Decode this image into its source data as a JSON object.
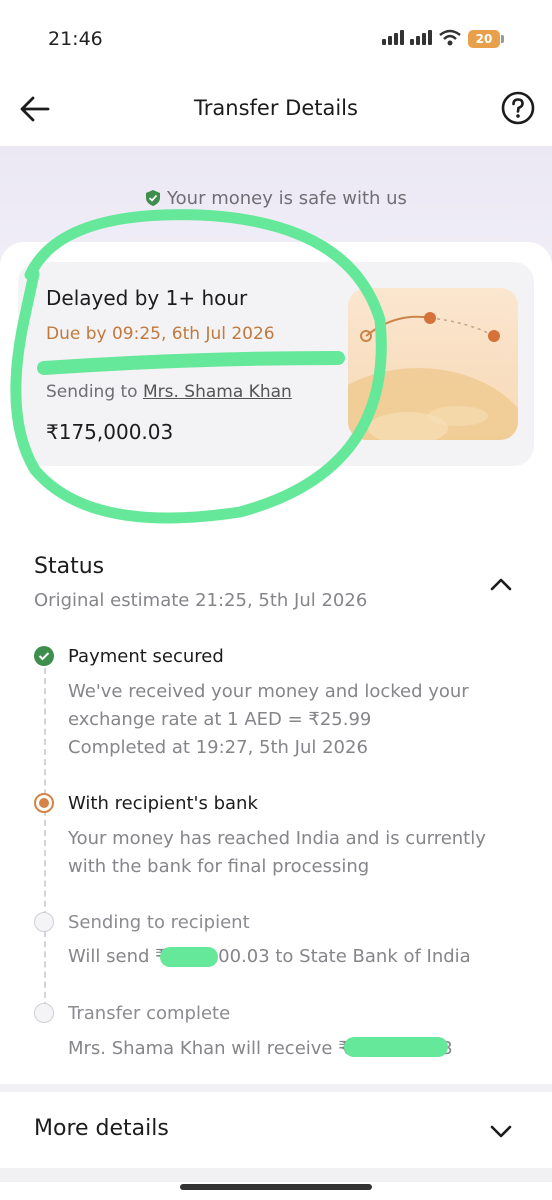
{
  "statusbar": {
    "time": "21:46",
    "battery": "20"
  },
  "header": {
    "title": "Transfer Details",
    "back_icon": "arrow-left-icon",
    "help_icon": "help-circle-icon"
  },
  "safe_banner": {
    "text": "Your money is safe with us",
    "icon": "shield-check-icon"
  },
  "transfer_card": {
    "status": "Delayed by 1+ hour",
    "due": "Due by 09:25, 6th Jul 2026",
    "sending_prefix": "Sending to ",
    "recipient": "Mrs. Shama Khan",
    "amount": "₹175,000.03"
  },
  "status_section": {
    "title": "Status",
    "original_estimate": "Original estimate 21:25, 5th Jul 2026",
    "steps": [
      {
        "title": "Payment secured",
        "state": "done",
        "lines": [
          "We've received your money and locked your",
          "exchange rate at 1 AED  = ₹25.99",
          "Completed at 19:27, 5th Jul 2026"
        ]
      },
      {
        "title": "With recipient's bank",
        "state": "active",
        "lines": [
          "Your money has reached India and is currently",
          "with the bank for final processing"
        ]
      },
      {
        "title": "Sending to recipient",
        "state": "pending",
        "lines": [
          "Will send ₹175,000.03 to State Bank of India"
        ]
      },
      {
        "title": "Transfer complete",
        "state": "pending",
        "lines": [
          "Mrs. Shama Khan will receive ₹175,000.03"
        ]
      }
    ]
  },
  "more_details": {
    "label": "More details"
  },
  "colors": {
    "accent": "#c07a3d",
    "success": "#3e8e4d",
    "highlight": "#66e89a"
  }
}
